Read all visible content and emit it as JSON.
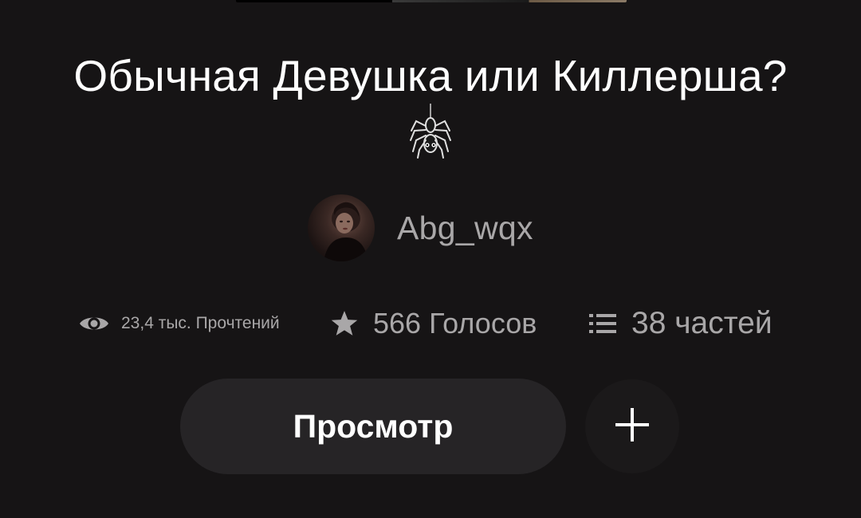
{
  "story": {
    "title": "Обычная Девушка или Киллерша?",
    "title_emoji_icon": "spider-icon",
    "author": {
      "name": "Abg_wqx",
      "avatar_icon": "avatar"
    },
    "stats": {
      "reads": {
        "icon": "eye-icon",
        "text": "23,4 тыс. Прочтений"
      },
      "votes": {
        "icon": "star-icon",
        "text": "566 Голосов"
      },
      "parts": {
        "icon": "list-icon",
        "text": "38 частей"
      }
    }
  },
  "actions": {
    "read_label": "Просмотр",
    "add_icon": "plus-icon"
  },
  "colors": {
    "background": "#161415",
    "title_text": "#ffffff",
    "secondary_text": "#a9a7a8",
    "button_bg": "#262426"
  }
}
